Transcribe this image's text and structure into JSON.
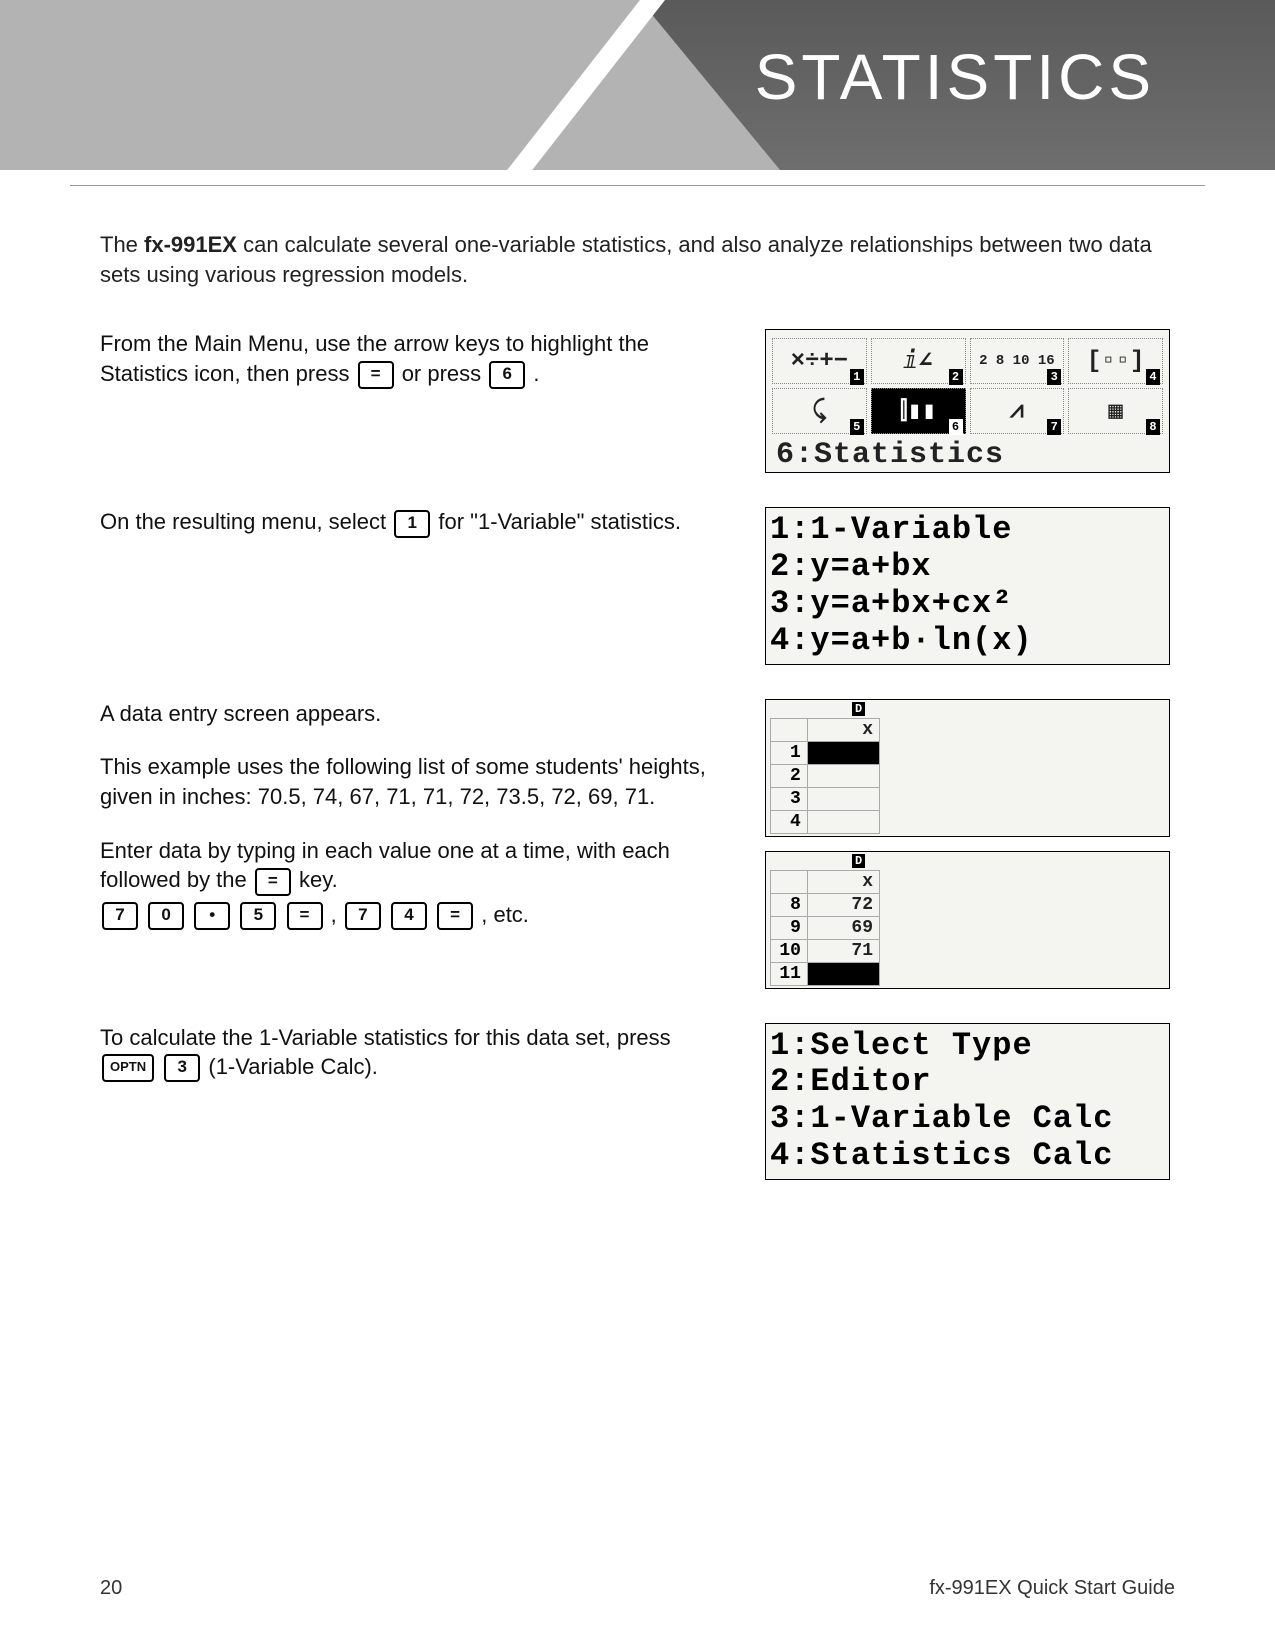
{
  "header": {
    "title": "STATISTICS"
  },
  "intro": {
    "text1": "The ",
    "model": "fx-991EX",
    "text2": " can calculate several one-variable statistics, and also analyze relationships between two data sets using various regression models."
  },
  "step1": {
    "text": "From the Main Menu, use the arrow keys to highlight the Statistics icon, then press ",
    "key1": "=",
    "mid": " or press ",
    "key2": "6",
    "end": " ."
  },
  "screen1": {
    "icons": [
      "×÷+−",
      "ⅈ∠",
      "2 8\n10 16",
      "[▫▫]",
      "⤹",
      "⫿▮▮",
      "⩘",
      "▦"
    ],
    "label": "6:Statistics"
  },
  "step2": {
    "text": "On the resulting menu, select ",
    "key": "1",
    "end": " for \"1-Variable\" statistics."
  },
  "screen2": {
    "lines": [
      "1:1-Variable",
      "2:y=a+bx",
      "3:y=a+bx+cx²",
      "4:y=a+b·ln(x)"
    ]
  },
  "step3": {
    "line1": "A data entry screen appears.",
    "line2": "This example uses the following list of some students' heights, given in inches: 70.5, 74, 67, 71, 71, 72, 73.5, 72, 69, 71.",
    "line3": "Enter data by typing in each value one at a time, with each followed by the ",
    "keyEq": "=",
    "line3end": " key.",
    "keys1": [
      "7",
      "0",
      "•",
      "5",
      "="
    ],
    "sep": " , ",
    "keys2": [
      "7",
      "4",
      "="
    ],
    "tail": " , etc."
  },
  "screen3": {
    "indicator": "D",
    "header": "x",
    "rows": [
      {
        "n": "1",
        "v": ""
      },
      {
        "n": "2",
        "v": ""
      },
      {
        "n": "3",
        "v": ""
      },
      {
        "n": "4",
        "v": ""
      }
    ]
  },
  "screen4": {
    "indicator": "D",
    "header": "x",
    "rows": [
      {
        "n": "8",
        "v": "72"
      },
      {
        "n": "9",
        "v": "69"
      },
      {
        "n": "10",
        "v": "71"
      },
      {
        "n": "11",
        "v": ""
      }
    ]
  },
  "step4": {
    "text1": "To calculate the 1-Variable statistics for this data set, press ",
    "keyOptn": "OPTN",
    "key3": "3",
    "text2": " (1-Variable Calc)."
  },
  "screen5": {
    "lines": [
      "1:Select Type",
      "2:Editor",
      "3:1-Variable Calc",
      "4:Statistics Calc"
    ]
  },
  "footer": {
    "page": "20",
    "guide": "fx-991EX Quick Start Guide"
  }
}
